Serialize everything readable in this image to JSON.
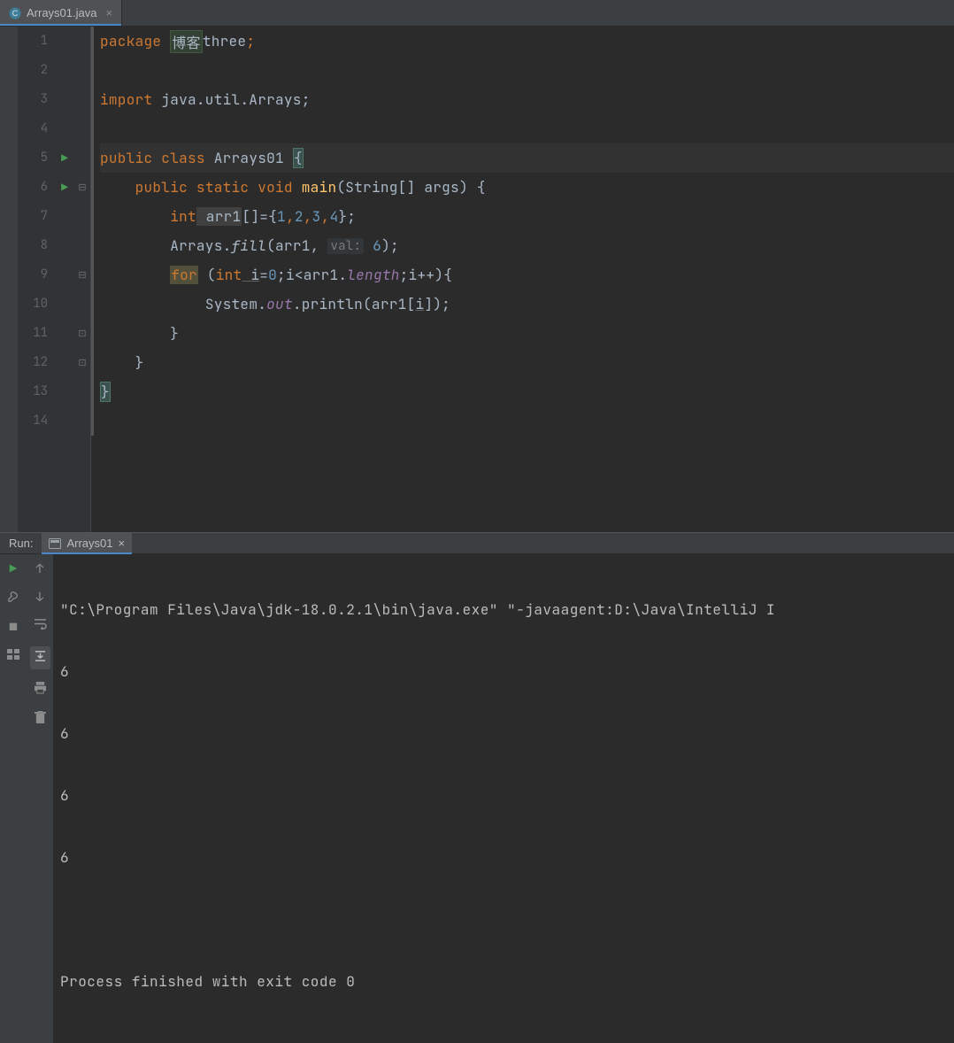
{
  "tab": {
    "filename": "Arrays01.java",
    "icon": "java-class-icon"
  },
  "gutter": {
    "line_numbers": [
      1,
      2,
      3,
      4,
      5,
      6,
      7,
      8,
      9,
      10,
      11,
      12,
      13,
      14
    ],
    "run_markers": [
      5,
      6
    ],
    "fold_open": [
      6,
      9
    ],
    "fold_close": [
      11,
      12
    ]
  },
  "code": {
    "l1_package": "package",
    "l1_pkg_hl": "博客",
    "l1_pkg_rest": "three",
    "l1_semi": ";",
    "l3_import": "import",
    "l3_path": " java.util.Arrays;",
    "l5_public": "public",
    "l5_class": " class",
    "l5_name": " Arrays01 ",
    "l5_brace": "{",
    "l6_public": "public",
    "l6_static": " static",
    "l6_void": " void",
    "l6_main": " main",
    "l6_params": "(String[] args) {",
    "l7_int": "int",
    "l7_arr": " arr1",
    "l7_mid": "[]={",
    "l7_n1": "1",
    "l7_n2": "2",
    "l7_n3": "3",
    "l7_n4": "4",
    "l7_end": "};",
    "l8_arrays": "Arrays.",
    "l8_fill": "fill",
    "l8_open": "(arr1, ",
    "l8_hint": "val:",
    "l8_val": " 6",
    "l8_close": ");",
    "l9_for": "for",
    "l9_open": " (",
    "l9_int": "int",
    "l9_i": " i",
    "l9_eq": "=",
    "l9_zero": "0",
    "l9_mid": ";i<arr1.",
    "l9_len": "length",
    "l9_end": ";i++){",
    "l10_sys": "System.",
    "l10_out": "out",
    "l10_print": ".println(arr1[",
    "l10_i": "i",
    "l10_close": "]);",
    "l11_brace": "}",
    "l12_brace": "}",
    "l13_brace": "}"
  },
  "run": {
    "label": "Run:",
    "config_name": "Arrays01",
    "cmd": "\"C:\\Program Files\\Java\\jdk-18.0.2.1\\bin\\java.exe\" \"-javaagent:D:\\Java\\IntelliJ I",
    "out1": "6",
    "out2": "6",
    "out3": "6",
    "out4": "6",
    "finished": "Process finished with exit code 0"
  }
}
